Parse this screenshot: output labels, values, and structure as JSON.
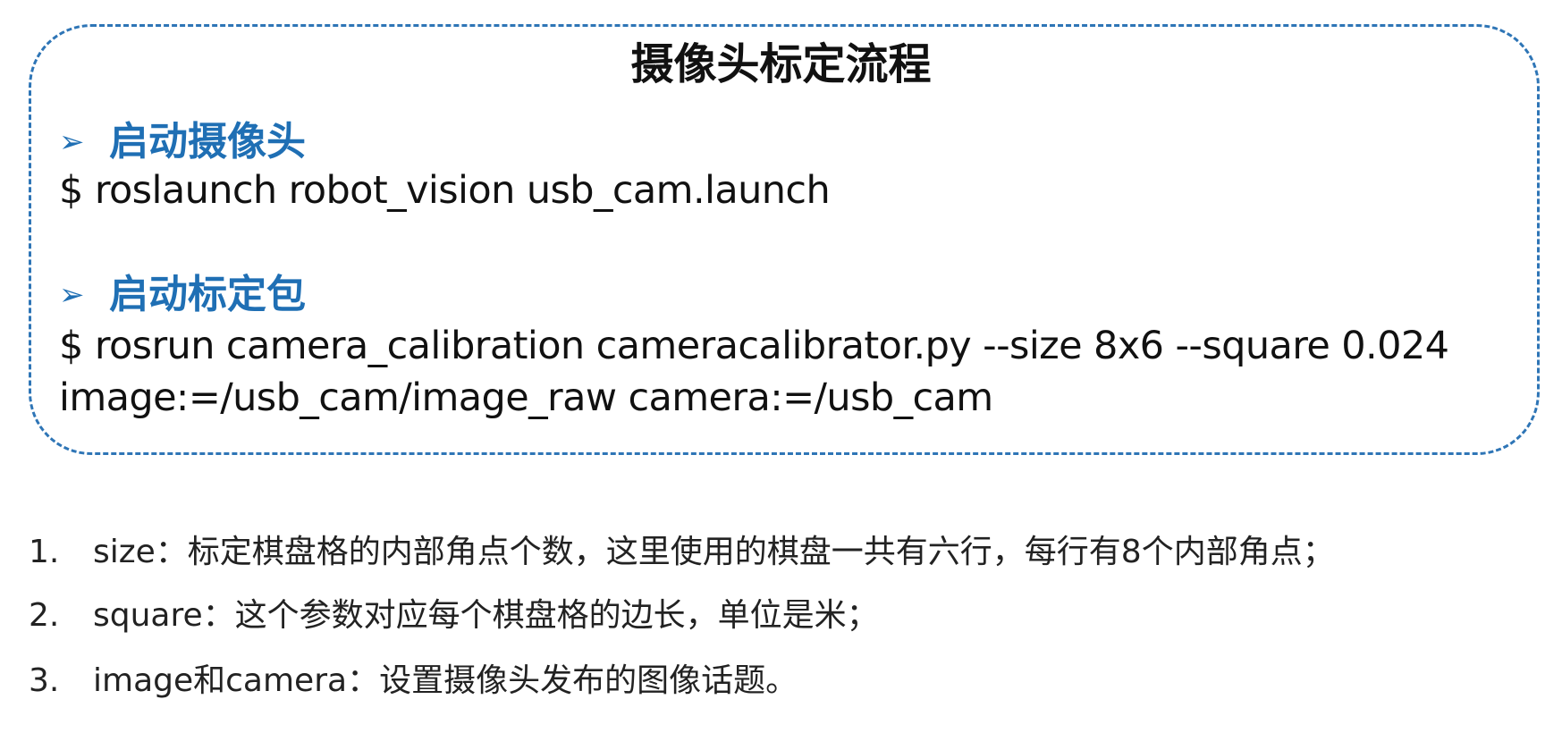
{
  "box": {
    "title": "摄像头标定流程",
    "border_color": "#2e75b6",
    "accent_color": "#1f6fb4",
    "sections": [
      {
        "bullet": "➢",
        "heading": "启动摄像头",
        "lines": [
          "$ roslaunch robot_vision usb_cam.launch"
        ]
      },
      {
        "bullet": "➢",
        "heading": "启动标定包",
        "lines": [
          "$ rosrun camera_calibration cameracalibrator.py --size 8x6 --square 0.024",
          "image:=/usb_cam/image_raw camera:=/usb_cam"
        ]
      }
    ]
  },
  "notes": [
    {
      "num": "1.",
      "text": "size：标定棋盘格的内部角点个数，这里使用的棋盘一共有六行，每行有8个内部角点；"
    },
    {
      "num": "2.",
      "text": "square：这个参数对应每个棋盘格的边长，单位是米；"
    },
    {
      "num": "3.",
      "text": "image和camera：设置摄像头发布的图像话题。"
    }
  ]
}
